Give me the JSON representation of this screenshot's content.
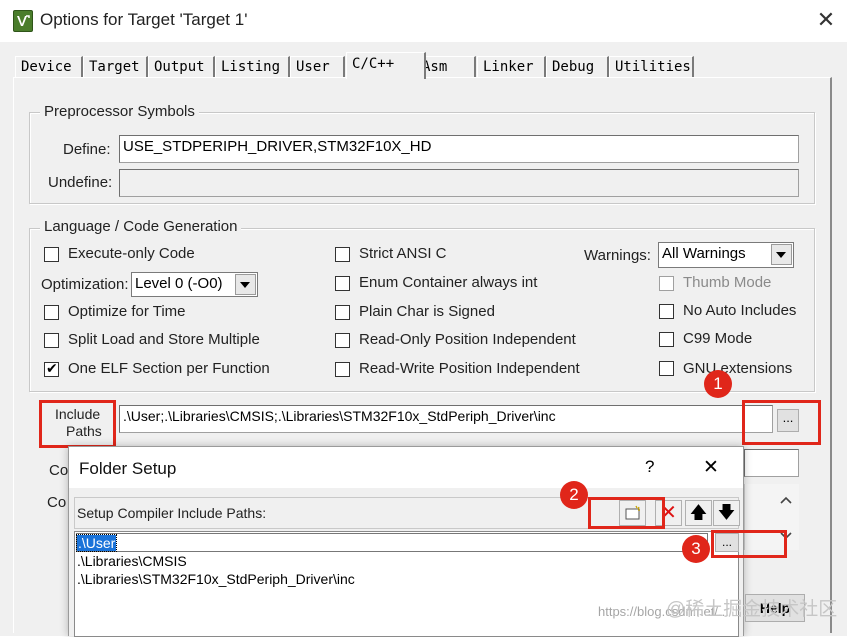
{
  "window": {
    "title": "Options for Target 'Target 1'",
    "close_glyph": "✕"
  },
  "tabs": [
    "Device",
    "Target",
    "Output",
    "Listing",
    "User",
    "C/C++",
    "Asm",
    "Linker",
    "Debug",
    "Utilities"
  ],
  "active_tab": "C/C++",
  "preprocessor": {
    "legend": "Preprocessor Symbols",
    "define_label": "Define:",
    "define_value": "USE_STDPERIPH_DRIVER,STM32F10X_HD",
    "undefine_label": "Undefine:",
    "undefine_value": ""
  },
  "codegen": {
    "legend": "Language / Code Generation",
    "execute_only": "Execute-only Code",
    "optimization_label": "Optimization:",
    "optimization_value": "Level 0 (-O0)",
    "optimize_time": "Optimize for Time",
    "split_load": "Split Load and Store Multiple",
    "one_elf": "One ELF Section per Function",
    "strict_ansi": "Strict ANSI C",
    "enum_container": "Enum Container always int",
    "plain_char": "Plain Char is Signed",
    "ro_position": "Read-Only Position Independent",
    "rw_position": "Read-Write Position Independent",
    "warnings_label": "Warnings:",
    "warnings_value": "All Warnings",
    "thumb_mode": "Thumb Mode",
    "no_auto_includes": "No Auto Includes",
    "c99_mode": "C99 Mode",
    "gnu_extensions": "GNU extensions"
  },
  "include": {
    "label_line1": "Include",
    "label_line2": "Paths",
    "value": ".\\User;.\\Libraries\\CMSIS;.\\Libraries\\STM32F10x_StdPeriph_Driver\\inc",
    "browse_label": "...",
    "misc_label_partial": "Co",
    "compiler_label_partial": "Co"
  },
  "badges": [
    "1",
    "2",
    "3"
  ],
  "folder_setup": {
    "title": "Folder Setup",
    "help_glyph": "?",
    "close_glyph": "✕",
    "list_title": "Setup Compiler Include Paths:",
    "paths": [
      ".\\User",
      ".\\Libraries\\CMSIS",
      ".\\Libraries\\STM32F10x_StdPeriph_Driver\\inc"
    ],
    "browse_label": "..."
  },
  "help_button": "Help",
  "watermark": {
    "url": "https://blog.csdn.net/...",
    "brand": "@稀土掘金技术社区"
  },
  "colors": {
    "highlight_red": "#e0261a",
    "selection_blue": "#1a73d9",
    "dialog_bg": "#f0f0f0"
  }
}
